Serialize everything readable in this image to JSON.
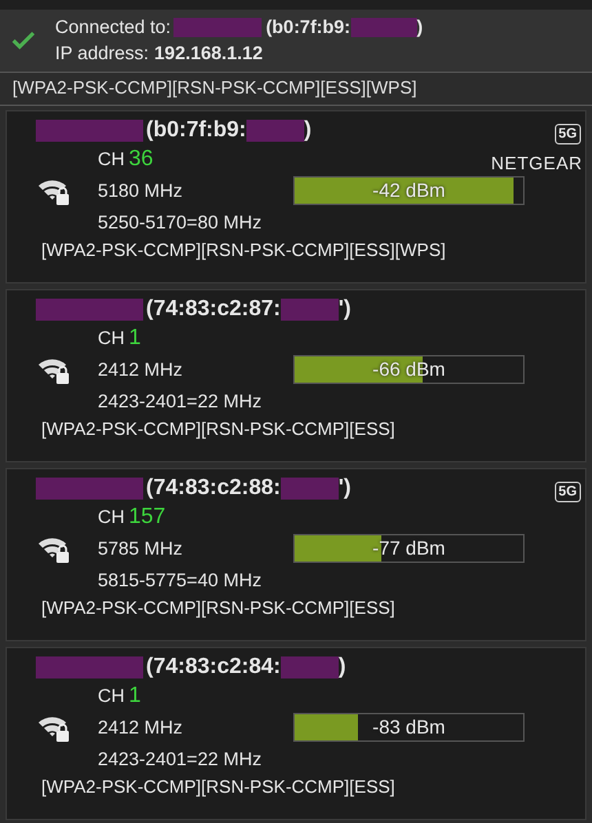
{
  "connection": {
    "label": "Connected to:",
    "ssid_redacted": true,
    "bssid_start": "(b0:7f:b9:",
    "bssid_end": ")",
    "ip_label": "IP address:",
    "ip": "192.168.1.12",
    "security": "[WPA2-PSK-CCMP][RSN-PSK-CCMP][ESS][WPS]"
  },
  "networks": [
    {
      "ssid_redacted": true,
      "bssid_start": "(b0:7f:b9:",
      "bssid_end": ")",
      "band_badge": "5G",
      "channel_label": "CH",
      "channel": "36",
      "frequency": "5180 MHz",
      "range": "5250-5170=80 MHz",
      "vendor": "NETGEAR",
      "level": 0.96,
      "reading": "-42 dBm",
      "security": "[WPA2-PSK-CCMP][RSN-PSK-CCMP][ESS][WPS]"
    },
    {
      "ssid_redacted": true,
      "bssid_start": "(74:83:c2:87:",
      "bssid_end": "')",
      "channel_label": "CH",
      "channel": "1",
      "frequency": "2412 MHz",
      "range": "2423-2401=22 MHz",
      "level": 0.56,
      "reading": "-66 dBm",
      "security": "[WPA2-PSK-CCMP][RSN-PSK-CCMP][ESS]"
    },
    {
      "ssid_redacted": true,
      "bssid_start": "(74:83:c2:88:",
      "bssid_end": "')",
      "band_badge": "5G",
      "channel_label": "CH",
      "channel": "157",
      "frequency": "5785 MHz",
      "range": "5815-5775=40 MHz",
      "level": 0.38,
      "reading": "-77 dBm",
      "security": "[WPA2-PSK-CCMP][RSN-PSK-CCMP][ESS]"
    },
    {
      "ssid_redacted": true,
      "bssid_start": "(74:83:c2:84:",
      "bssid_end": ")",
      "channel_label": "CH",
      "channel": "1",
      "frequency": "2412 MHz",
      "range": "2423-2401=22 MHz",
      "level": 0.28,
      "reading": "-83 dBm",
      "security": "[WPA2-PSK-CCMP][RSN-PSK-CCMP][ESS]"
    }
  ]
}
